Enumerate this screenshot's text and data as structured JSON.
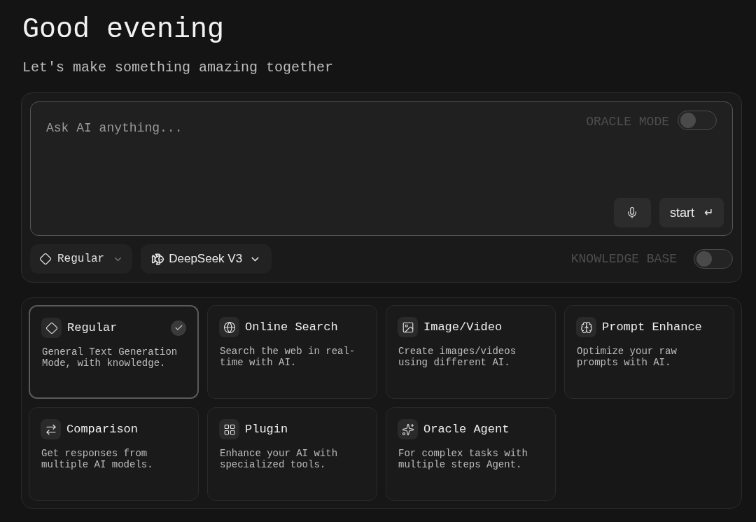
{
  "greeting": "Good evening",
  "subtitle": "Let's make something amazing together",
  "prompt": {
    "placeholder": "Ask AI anything...",
    "oracle_mode": {
      "label": "ORACLE MODE",
      "on": false
    },
    "start_label": "start",
    "start_key": "↵"
  },
  "mode_dropdown": {
    "label": "Regular"
  },
  "model_dropdown": {
    "label": "DeepSeek V3"
  },
  "knowledge_base": {
    "label": "KNOWLEDGE BASE",
    "on": false
  },
  "modes": [
    {
      "kind": "regular",
      "title": "Regular",
      "description": "General Text Generation Mode, with knowledge.",
      "selected": true
    },
    {
      "kind": "search",
      "title": "Online Search",
      "description": "Search the web in real-time with AI.",
      "selected": false
    },
    {
      "kind": "image",
      "title": "Image/Video",
      "description": "Create images/videos using different AI.",
      "selected": false
    },
    {
      "kind": "enhance",
      "title": "Prompt Enhance",
      "description": "Optimize your raw prompts with AI.",
      "selected": false
    },
    {
      "kind": "comparison",
      "title": "Comparison",
      "description": "Get responses from multiple AI models.",
      "selected": false
    },
    {
      "kind": "plugin",
      "title": "Plugin",
      "description": "Enhance your AI with specialized tools.",
      "selected": false
    },
    {
      "kind": "agent",
      "title": "Oracle Agent",
      "description": "For complex tasks with multiple steps Agent.",
      "selected": false
    }
  ]
}
